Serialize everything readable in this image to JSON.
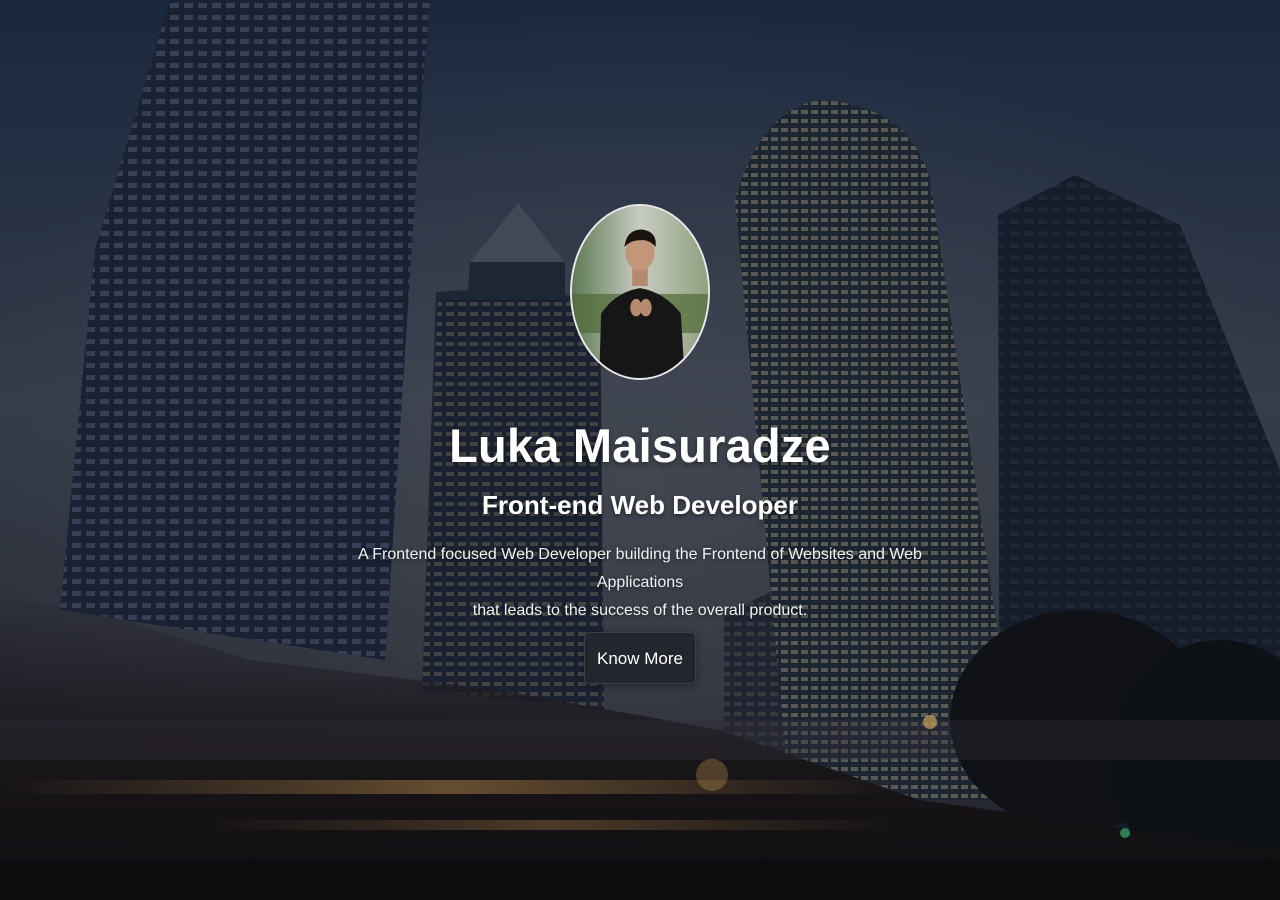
{
  "hero": {
    "name": "Luka Maisuradze",
    "role": "Front-end Web Developer",
    "description_line1": "A Frontend focused Web Developer building the Frontend of Websites and Web Applications",
    "description_line2": "that leads to the success of the overall product.",
    "cta_label": "Know More"
  },
  "icons": {
    "avatar": "profile-photo",
    "background": "city-skyscrapers-photo"
  },
  "colors": {
    "text": "#ffffff",
    "button_bg": "#23272d",
    "sky_top": "#1a2b44"
  }
}
